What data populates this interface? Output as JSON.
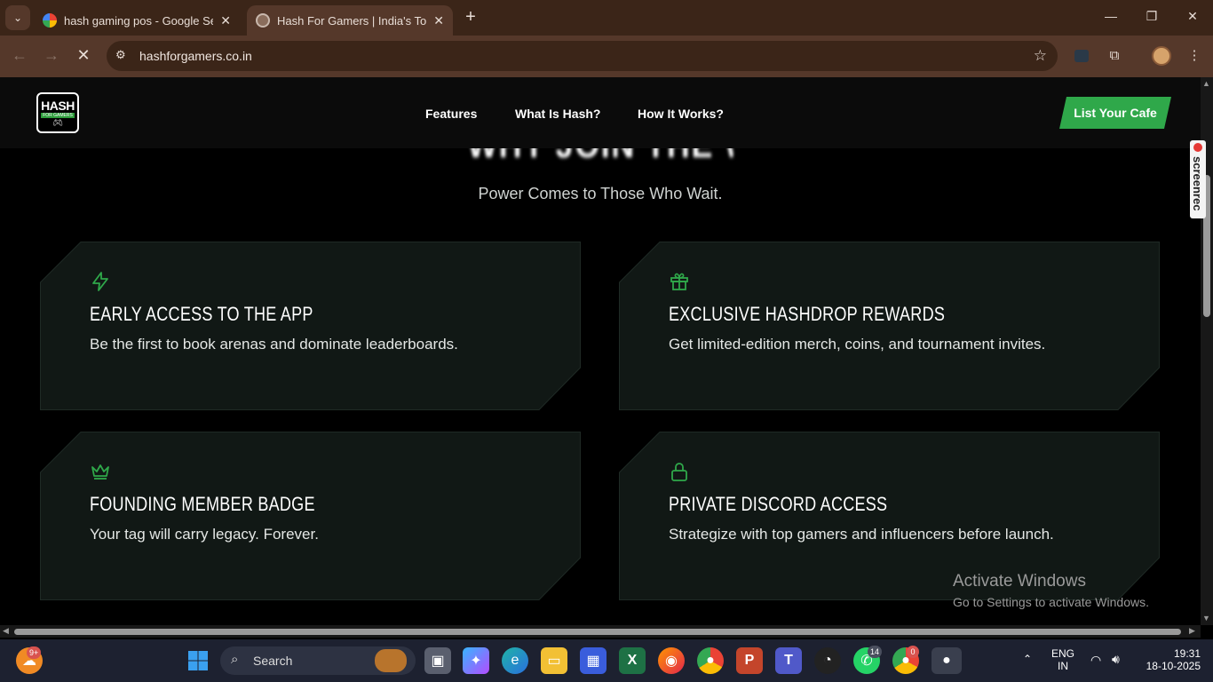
{
  "browser": {
    "tabs": [
      {
        "title": "hash gaming pos - Google Sear",
        "active": false
      },
      {
        "title": "Hash For Gamers | India's Top G",
        "active": true
      }
    ],
    "url": "hashforgamers.co.in"
  },
  "site": {
    "logo": {
      "big": "HASH",
      "small": "FOR GAMERS"
    },
    "nav": [
      "Features",
      "What Is Hash?",
      "How It Works?"
    ],
    "cta": "List Your Cafe",
    "heading_partial": "WHY JOIN THE WAITLIST?",
    "subtitle": "Power Comes to Those Who Wait.",
    "cards": [
      {
        "icon": "lightning-icon",
        "title": "EARLY ACCESS TO THE APP",
        "desc": "Be the first to book arenas and dominate leaderboards."
      },
      {
        "icon": "gift-icon",
        "title": "EXCLUSIVE HASHDROP REWARDS",
        "desc": "Get limited-edition merch, coins, and tournament invites."
      },
      {
        "icon": "crown-icon",
        "title": "FOUNDING MEMBER BADGE",
        "desc": "Your tag will carry legacy. Forever."
      },
      {
        "icon": "lock-icon",
        "title": "PRIVATE DISCORD ACCESS",
        "desc": "Strategize with top gamers and influencers before launch."
      }
    ],
    "accent": "#2fa84a",
    "card_bg": "#111815",
    "card_border": "#1f2a25"
  },
  "overlay": {
    "activate_title": "Activate Windows",
    "activate_sub": "Go to Settings to activate Windows.",
    "screenrec": "screenrec"
  },
  "taskbar": {
    "weather_badge": "9+",
    "search": "Search",
    "whatsapp_badge": "14",
    "chrome_badge": "0",
    "lang1": "ENG",
    "lang2": "IN",
    "time": "19:31",
    "date": "18-10-2025"
  }
}
